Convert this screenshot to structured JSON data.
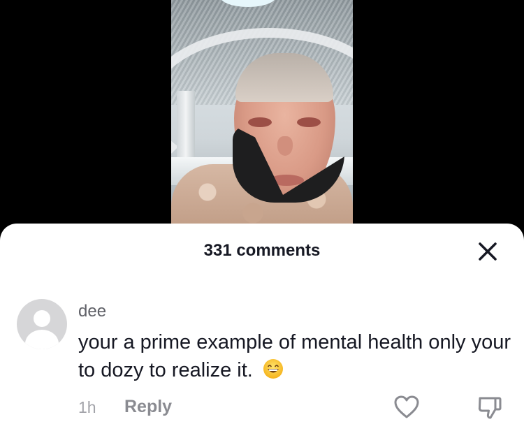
{
  "comments_sheet": {
    "title": "331 comments",
    "close_icon": "close-icon"
  },
  "comment": {
    "username": "dee",
    "text": "your a prime example of mental health only your to dozy to realize it.",
    "emoji": "grinning-face-with-smiling-eyes",
    "timestamp": "1h",
    "reply_label": "Reply",
    "like_icon": "heart-icon",
    "dislike_icon": "thumbs-down-icon",
    "avatar_icon": "default-avatar-icon"
  },
  "video": {
    "description": ""
  },
  "colors": {
    "sheet_background": "#ffffff",
    "primary_text": "#161823",
    "secondary_text": "#8a8b91",
    "avatar_background": "#d6d6d8"
  }
}
